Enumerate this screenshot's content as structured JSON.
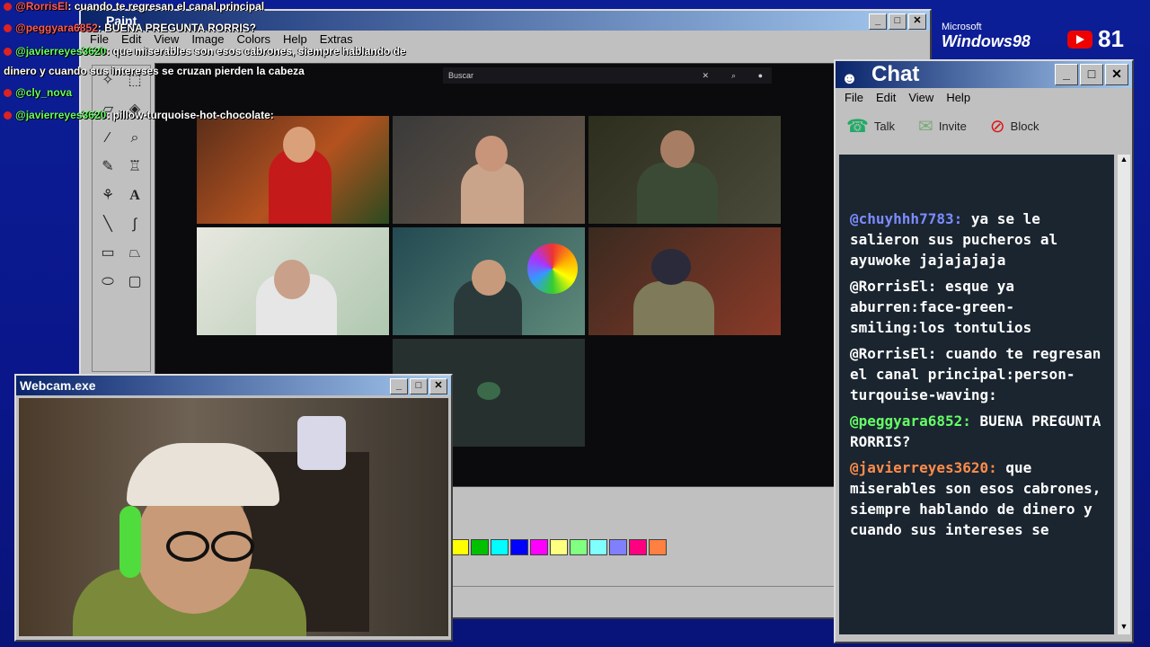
{
  "overlay_chat": [
    {
      "user": "@RorrisEl",
      "text": ": cuando te regresan el canal principal",
      "color": "#ff5c5c"
    },
    {
      "user": "@peggyara6852",
      "text": ": BUENA PREGUNTA RORRIS?",
      "color": "#ff5c5c"
    },
    {
      "user": "@javierreyes3620",
      "text": ": que miserables son esos cabrones, siempre hablando de",
      "color": "#66ff66"
    },
    {
      "user": "",
      "text": "dinero y cuando sus intereses se cruzan pierden la cabeza",
      "color": "#ffffff"
    },
    {
      "user": "@cly_nova",
      "text": "",
      "color": "#66ff66"
    },
    {
      "user": "@javierreyes3620",
      "text": ": pillow-turquoise-hot-chocolate:",
      "color": "#66ff66"
    }
  ],
  "paint": {
    "title": "Paint",
    "menu": [
      "File",
      "Edit",
      "View",
      "Image",
      "Colors",
      "Help",
      "Extras"
    ],
    "search_placeholder": "Buscar",
    "palette": [
      "#ffff00",
      "#00c000",
      "#00ffff",
      "#0000ff",
      "#ff00ff",
      "#ffff80",
      "#80ff80",
      "#80ffff",
      "#8080ff",
      "#ff0080",
      "#ff8040"
    ]
  },
  "webcam": {
    "title": "Webcam.exe"
  },
  "chat": {
    "title": "Chat",
    "menu": [
      "File",
      "Edit",
      "View",
      "Help"
    ],
    "tools": [
      {
        "label": "Talk",
        "icon": "phone-icon"
      },
      {
        "label": "Invite",
        "icon": "invite-icon"
      },
      {
        "label": "Block",
        "icon": "block-icon"
      }
    ],
    "messages": [
      {
        "user": "@chuyhhh7783:",
        "text": " ya se le salieron sus pucheros al ayuwoke jajajajaja",
        "color": "#7c8cff"
      },
      {
        "user": "@RorrisEl:",
        "text": " esque ya aburren:face-green-smiling:los tontulios",
        "color": "#ffffff"
      },
      {
        "user": "@RorrisEl:",
        "text": " cuando te regresan el canal principal:person-turqouise-waving:",
        "color": "#ffffff"
      },
      {
        "user": "@peggyara6852:",
        "text": " BUENA PREGUNTA RORRIS?",
        "color": "#66ff66"
      },
      {
        "user": "@javierreyes3620:",
        "text": " que miserables son esos cabrones, siempre hablando de dinero y cuando sus intereses se",
        "color": "#ff8c4a"
      }
    ]
  },
  "badge": {
    "brand_top": "Microsoft",
    "brand": "Windows98",
    "viewers": "81"
  }
}
